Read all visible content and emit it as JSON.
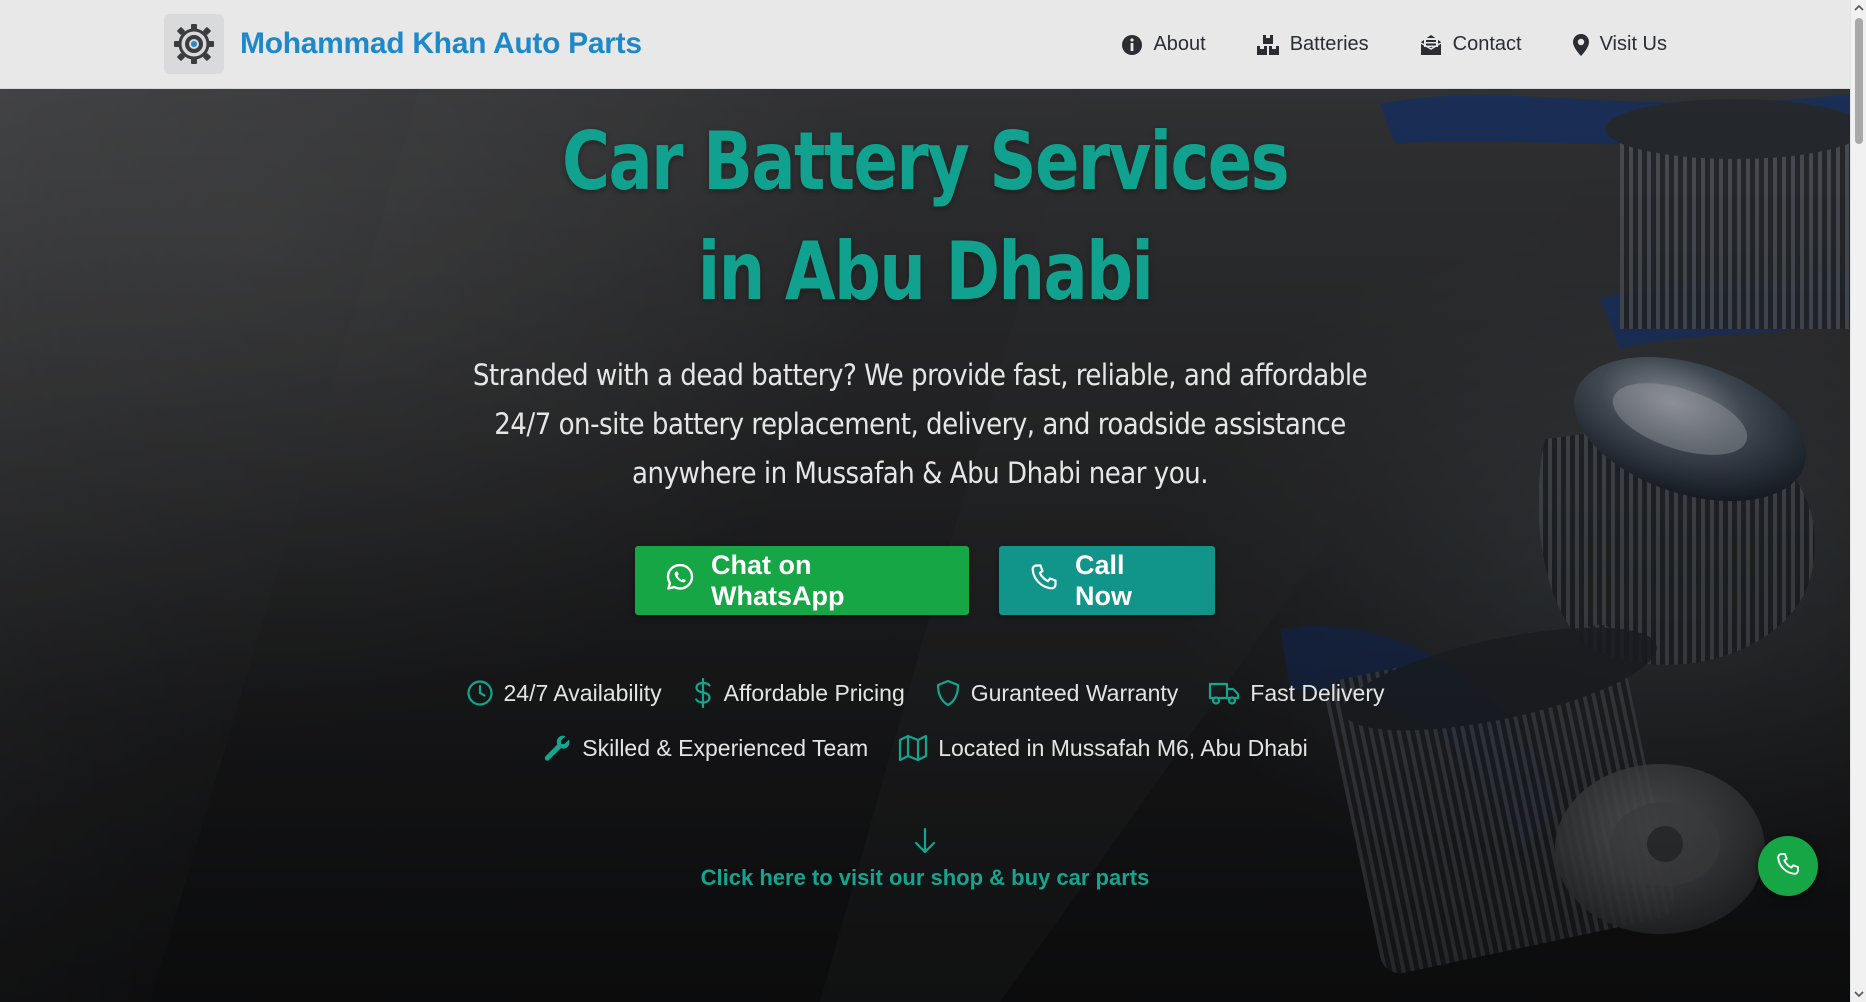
{
  "brand": {
    "name": "Mohammad Khan Auto Parts",
    "logo_icon": "gear-logo-icon",
    "color": "#1e88c9"
  },
  "nav": {
    "items": [
      {
        "label": "About",
        "icon": "info-icon"
      },
      {
        "label": "Batteries",
        "icon": "boxes-icon"
      },
      {
        "label": "Contact",
        "icon": "envelope-icon"
      },
      {
        "label": "Visit Us",
        "icon": "map-pin-icon"
      }
    ]
  },
  "hero": {
    "title_line1": "Car Battery Services",
    "title_line2": "in Abu Dhabi",
    "subtitle": "Stranded with a dead battery? We provide fast, reliable, and affordable 24/7 on-site battery replacement, delivery, and roadside assistance anywhere in Mussafah & Abu Dhabi near you.",
    "accent_color": "#10a18f"
  },
  "cta": {
    "whatsapp_label": "Chat on WhatsApp",
    "whatsapp_color": "#17a645",
    "call_label": "Call Now",
    "call_color": "#11948a"
  },
  "features": {
    "row1": [
      {
        "label": "24/7 Availability",
        "icon": "clock-icon"
      },
      {
        "label": "Affordable Pricing",
        "icon": "dollar-icon"
      },
      {
        "label": "Guranteed Warranty",
        "icon": "shield-icon"
      },
      {
        "label": "Fast Delivery",
        "icon": "truck-icon"
      }
    ],
    "row2": [
      {
        "label": "Skilled & Experienced Team",
        "icon": "wrench-icon"
      },
      {
        "label": "Located in Mussafah M6, Abu Dhabi",
        "icon": "map-icon"
      }
    ]
  },
  "shop_link": {
    "label": "Click here to visit our shop & buy car parts",
    "icon": "arrow-down-icon"
  },
  "floating_button": {
    "icon": "phone-icon"
  }
}
